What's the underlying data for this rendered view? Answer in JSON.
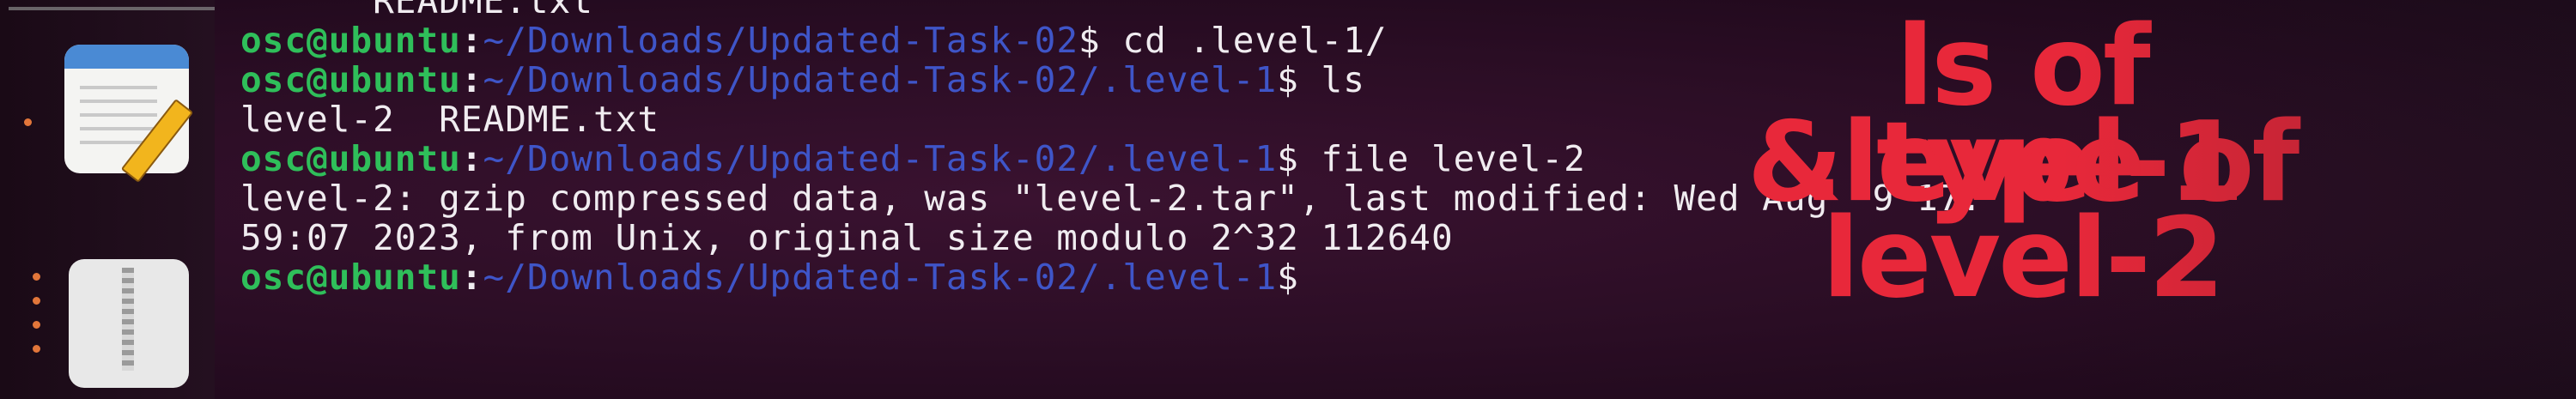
{
  "terminal": {
    "lines": [
      {
        "type": "output",
        "text": "      README.txt"
      },
      {
        "type": "prompt",
        "user": "osc@ubuntu",
        "colon": ":",
        "path": "~/Downloads/Updated-Task-02",
        "dollar": "$ ",
        "cmd": "cd .level-1/"
      },
      {
        "type": "prompt",
        "user": "osc@ubuntu",
        "colon": ":",
        "path": "~/Downloads/Updated-Task-02/.level-1",
        "dollar": "$ ",
        "cmd": "ls"
      },
      {
        "type": "output",
        "text": "level-2  README.txt"
      },
      {
        "type": "prompt",
        "user": "osc@ubuntu",
        "colon": ":",
        "path": "~/Downloads/Updated-Task-02/.level-1",
        "dollar": "$ ",
        "cmd": "file level-2"
      },
      {
        "type": "output",
        "text": "level-2: gzip compressed data, was \"level-2.tar\", last modified: Wed Aug  9 17:"
      },
      {
        "type": "output",
        "text": "59:07 2023, from Unix, original size modulo 2^32 112640"
      },
      {
        "type": "prompt",
        "user": "osc@ubuntu",
        "colon": ":",
        "path": "~/Downloads/Updated-Task-02/.level-1",
        "dollar": "$ ",
        "cmd": ""
      }
    ]
  },
  "annotation": {
    "line1": "ls of .level-1",
    "line2": "& type of",
    "line3": "level-2"
  },
  "dock": {
    "apps": [
      {
        "icon": "text-editor-icon"
      },
      {
        "icon": "archive-manager-icon"
      }
    ]
  },
  "colors": {
    "user": "#2fbf5a",
    "path": "#3f55c8",
    "annotation": "#e8283a",
    "background": "#2a0d24"
  }
}
